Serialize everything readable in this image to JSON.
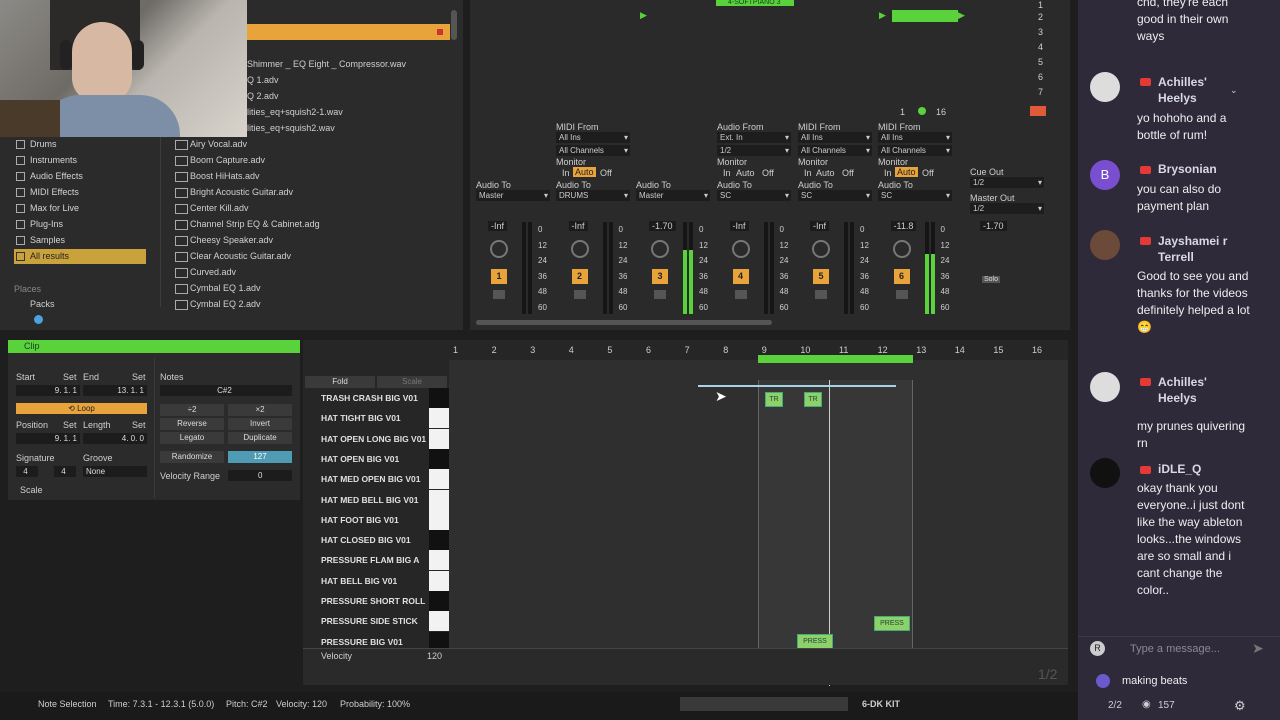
{
  "browser": {
    "categories": [
      {
        "label": "Drums",
        "active": false
      },
      {
        "label": "Instruments",
        "active": false
      },
      {
        "label": "Audio Effects",
        "active": false
      },
      {
        "label": "MIDI Effects",
        "active": false
      },
      {
        "label": "Max for Live",
        "active": false
      },
      {
        "label": "Plug-Ins",
        "active": false
      },
      {
        "label": "Samples",
        "active": false
      },
      {
        "label": "All results",
        "active": true
      }
    ],
    "places_label": "Places",
    "packs_label": "Packs",
    "top_files": [
      "Shimmer _ EQ Eight _ Compressor.wav",
      "Q 1.adv",
      "Q 2.adv",
      "lities_eq+squish2-1.wav",
      "lities_eq+squish2.wav"
    ],
    "files": [
      "Airy Vocal.adv",
      "Boom Capture.adv",
      "Boost HiHats.adv",
      "Bright Acoustic Guitar.adv",
      "Center Kill.adv",
      "Channel Strip EQ & Cabinet.adg",
      "Cheesy Speaker.adv",
      "Clear Acoustic Guitar.adv",
      "Curved.adv",
      "Cymbal EQ 1.adv",
      "Cymbal EQ 2.adv"
    ]
  },
  "mixer": {
    "tracks": [
      {
        "num": "1",
        "audio_to": "Audio To",
        "dest": "Master",
        "vol": "-Inf",
        "meter": 0
      },
      {
        "num": "2",
        "midi_from": "MIDI From",
        "src": "All Ins",
        "channels": "All Channels",
        "audio_to": "Audio To",
        "dest": "DRUMS",
        "vol": "-Inf",
        "meter": 0
      },
      {
        "num": "3",
        "audio_to": "Audio To",
        "dest": "Master",
        "vol": "-1.70",
        "meter": 0.7
      },
      {
        "num": "4",
        "midi_from": "Audio From",
        "src": "Ext. In",
        "channels": "1/2",
        "audio_to": "Audio To",
        "dest": "SC",
        "vol": "-Inf",
        "meter": 0
      },
      {
        "num": "5",
        "midi_from": "MIDI From",
        "src": "All Ins",
        "channels": "All Channels",
        "audio_to": "Audio To",
        "dest": "SC",
        "vol": "-Inf",
        "meter": 0
      },
      {
        "num": "6",
        "midi_from": "MIDI From",
        "src": "All Ins",
        "channels": "All Channels",
        "audio_to": "Audio To",
        "dest": "SC",
        "vol": "-11.8",
        "meter": 0.65
      }
    ],
    "monitor_label": "Monitor",
    "monitor_opts": [
      "In",
      "Auto",
      "Off"
    ],
    "db_scale": [
      "0",
      "12",
      "24",
      "36",
      "48",
      "60"
    ],
    "cue_out_label": "Cue Out",
    "cue_out_value": "1/2",
    "master_out_label": "Master Out",
    "master_out_value": "1/2",
    "master_vol": "-1.70",
    "solo_label": "Solo",
    "clip_name": "4-SOFTPIANO 3",
    "scene_numbers": [
      "1",
      "2",
      "3",
      "4",
      "5",
      "6",
      "7"
    ],
    "transport_values": [
      "1",
      "16"
    ]
  },
  "clip": {
    "title": "Clip",
    "start_label": "Start",
    "set_label": "Set",
    "end_label": "End",
    "start_value": "9.   1.   1",
    "end_value": "13.   1.   1",
    "loop_label": "Loop",
    "position_label": "Position",
    "length_label": "Length",
    "position_value": "9.   1.   1",
    "length_value": "4.   0.   0",
    "signature_label": "Signature",
    "groove_label": "Groove",
    "sig_num": "4",
    "sig_den": "4",
    "groove_value": "None",
    "scale_label": "Scale",
    "notes_label": "Notes",
    "note_value": "C#2",
    "div2": "÷2",
    "times2": "×2",
    "reverse": "Reverse",
    "invert": "Invert",
    "legato": "Legato",
    "duplicate": "Duplicate",
    "randomize": "Randomize",
    "rand_value": "127",
    "velocity_range_label": "Velocity Range",
    "velocity_range_value": "0"
  },
  "roll": {
    "fold_label": "Fold",
    "scale_label": "Scale",
    "bars": [
      "1",
      "2",
      "3",
      "4",
      "5",
      "6",
      "7",
      "8",
      "9",
      "10",
      "11",
      "12",
      "13",
      "14",
      "15",
      "16"
    ],
    "lanes": [
      {
        "label": "TRASH CRASH BIG V01",
        "white": false
      },
      {
        "label": "HAT TIGHT BIG V01",
        "white": true
      },
      {
        "label": "HAT OPEN LONG BIG V01",
        "white": true
      },
      {
        "label": "HAT OPEN BIG V01",
        "white": false
      },
      {
        "label": "HAT MED OPEN BIG V01",
        "white": true
      },
      {
        "label": "HAT MED BELL BIG V01",
        "white": true
      },
      {
        "label": "HAT FOOT BIG V01",
        "white": true
      },
      {
        "label": "HAT CLOSED BIG V01",
        "white": false
      },
      {
        "label": "PRESSURE FLAM BIG A",
        "white": true
      },
      {
        "label": "HAT BELL BIG V01",
        "white": true
      },
      {
        "label": "PRESSURE SHORT ROLL BI",
        "white": false
      },
      {
        "label": "PRESSURE SIDE STICK BIG",
        "white": true
      },
      {
        "label": "PRESSURE BIG V01",
        "white": false
      }
    ],
    "notes": [
      {
        "label": "TR"
      },
      {
        "label": "TR"
      },
      {
        "label": "PRESS"
      },
      {
        "label": "PRESS"
      }
    ],
    "velocity_label": "Velocity",
    "velocity_value": "120",
    "page_indicator": "1/2"
  },
  "status": {
    "mode": "Note Selection",
    "time": "Time: 7.3.1 - 12.3.1 (5.0.0)",
    "pitch": "Pitch: C#2",
    "velocity": "Velocity: 120",
    "probability": "Probability: 100%",
    "device": "6-DK KIT"
  },
  "chat": {
    "messages": [
      {
        "name": "",
        "text": "and, they're each good in their own ways",
        "lead": "cnd, they're each good in their own ways"
      },
      {
        "name": "Achilles' Heelys",
        "text": "yo hohoho and a bottle of rum!"
      },
      {
        "name": "Brysonian",
        "text": "you can also do payment plan",
        "initial": "B"
      },
      {
        "name": "Jayshamei r Terrell",
        "text": "Good to see you and thanks for the videos definitely helped a lot 😁"
      },
      {
        "name": "Achilles' Heelys",
        "text": "my prunes quivering rn"
      },
      {
        "name": "iDLE_Q",
        "text": "okay thank you everyone..i just dont like the way ableton looks...the windows are so small and i cant change the color.."
      }
    ],
    "input_initial": "R",
    "input_placeholder": "Type a message...",
    "footer_title": "making beats",
    "page": "2/2",
    "views": "157"
  }
}
